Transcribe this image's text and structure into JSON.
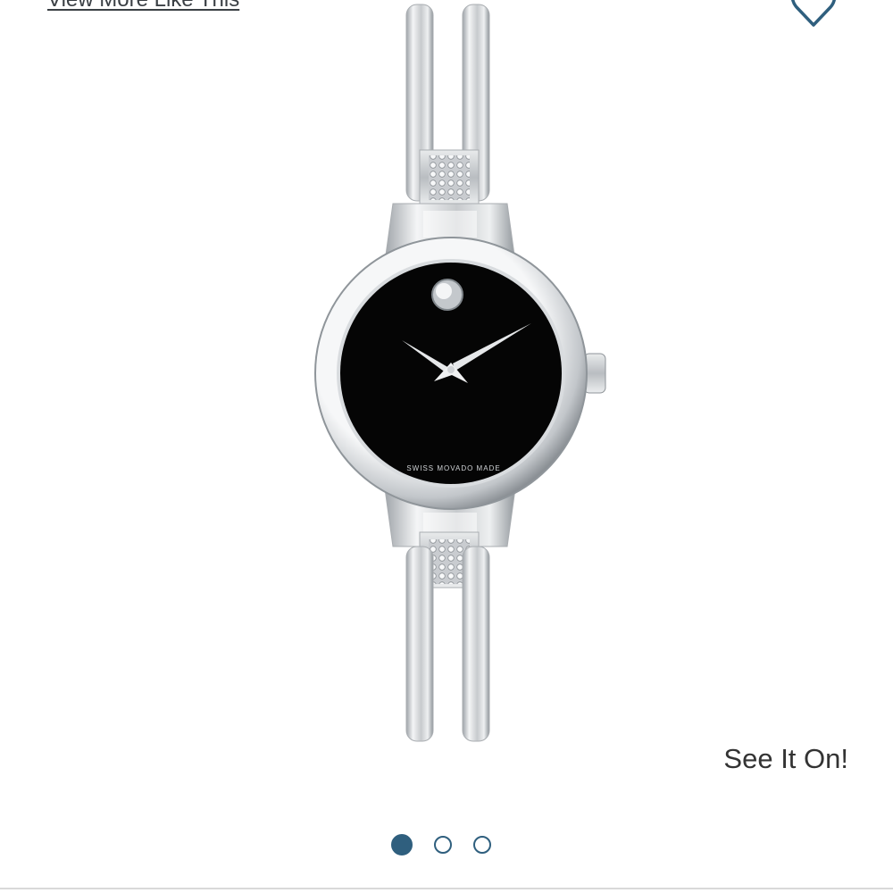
{
  "links": {
    "view_more": "View More Like This"
  },
  "icons": {
    "favorite": "heart-outline-icon"
  },
  "product": {
    "image_alt": "watch-product-image",
    "dial_text": "SWISS MOVADO MADE"
  },
  "actions": {
    "see_it_on": "See It On!"
  },
  "carousel": {
    "total": 3,
    "active_index": 1
  },
  "colors": {
    "accent": "#2f5f7e",
    "text": "#333333"
  }
}
